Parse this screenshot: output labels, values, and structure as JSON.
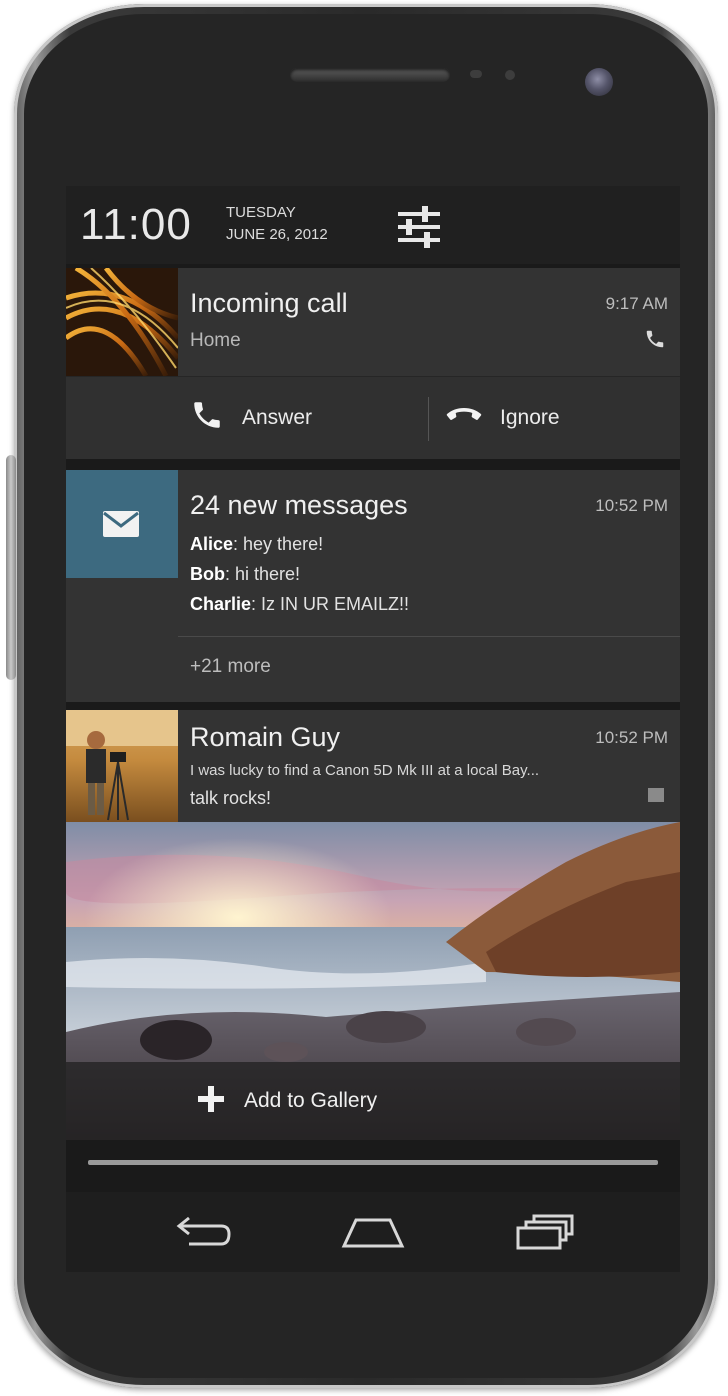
{
  "status": {
    "time": "11:00",
    "day": "TUESDAY",
    "date": "JUNE 26, 2012",
    "settings_icon": "settings-sliders-icon"
  },
  "call_notification": {
    "title": "Incoming call",
    "subtitle": "Home",
    "time": "9:17 AM",
    "icon": "phone-icon",
    "actions": {
      "answer_label": "Answer",
      "ignore_label": "Ignore"
    }
  },
  "email_notification": {
    "title": "24 new messages",
    "time": "10:52 PM",
    "icon": "envelope-icon",
    "icon_bg": "#3d6a80",
    "messages": [
      {
        "sender": "Alice",
        "text": ": hey there!"
      },
      {
        "sender": "Bob",
        "text": ": hi there!"
      },
      {
        "sender": "Charlie",
        "text": ": Iz IN UR EMAILZ!!"
      }
    ],
    "more": "+21 more"
  },
  "photo_notification": {
    "title": "Romain Guy",
    "time": "10:52 PM",
    "line1": "I was lucky to find a Canon 5D Mk III at a local Bay...",
    "line2": "talk rocks!",
    "action_label": "Add to Gallery"
  },
  "nav": {
    "back_icon": "back-icon",
    "home_icon": "home-icon",
    "recents_icon": "recent-apps-icon"
  }
}
